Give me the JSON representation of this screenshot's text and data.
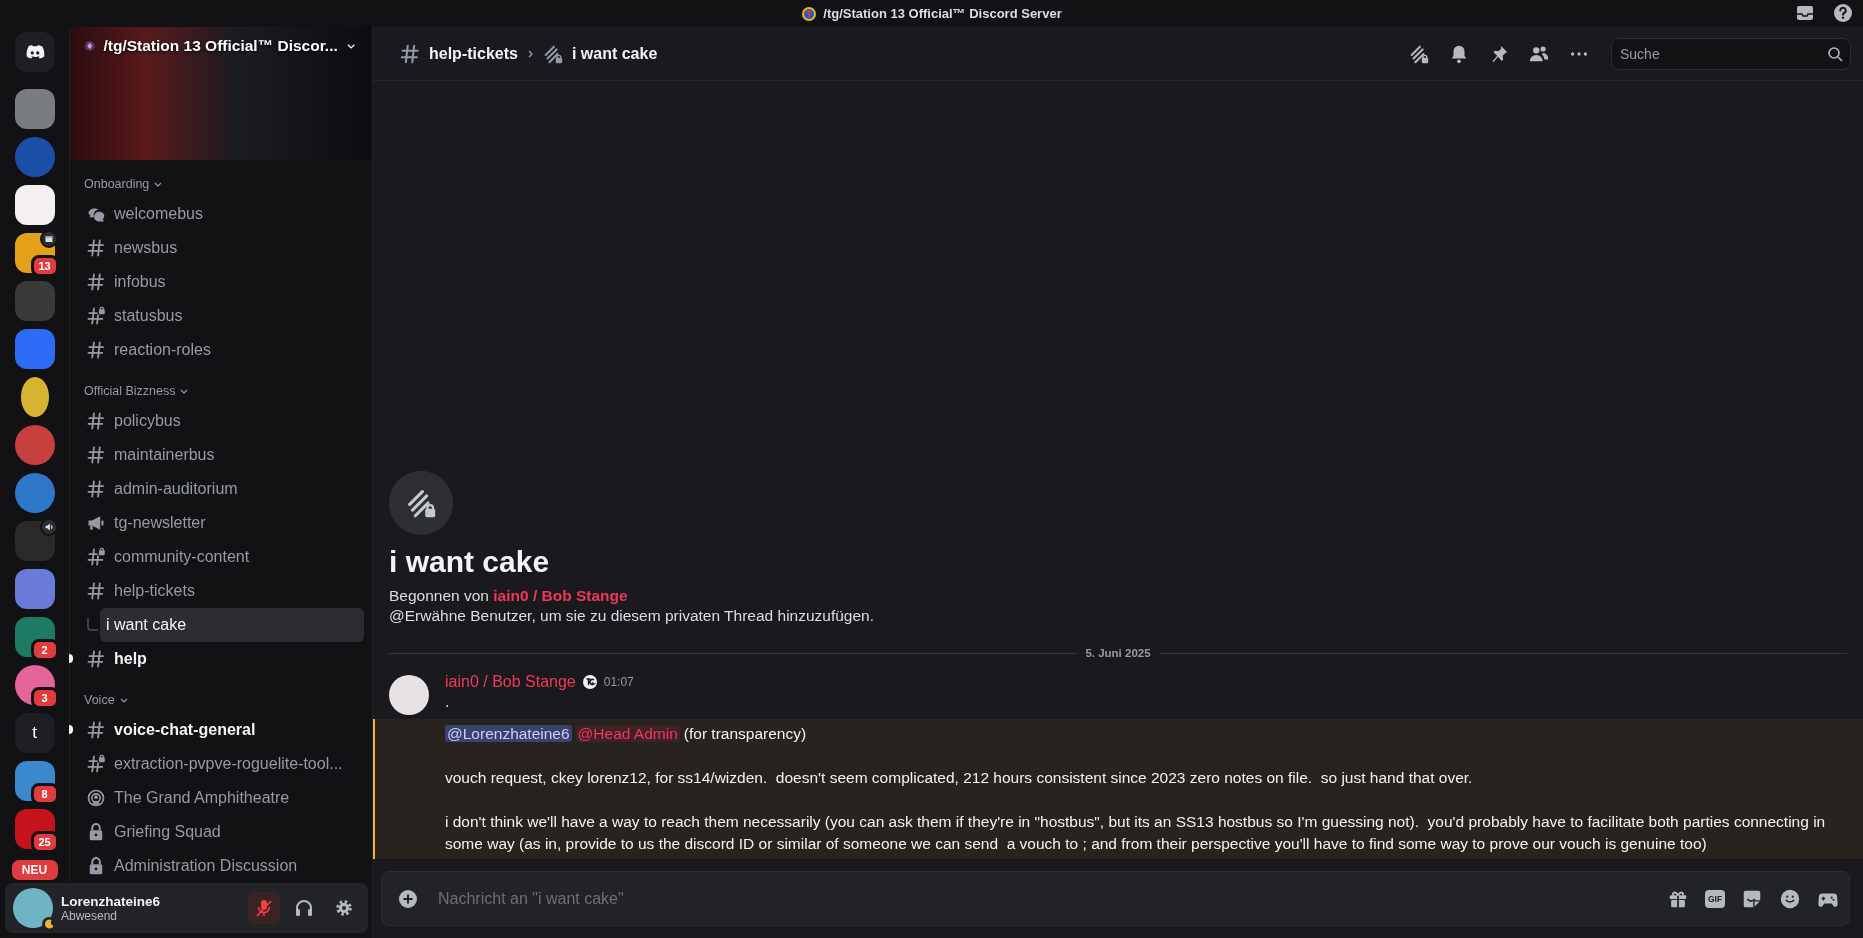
{
  "title_bar": {
    "title": "/tg/Station 13 Official™ Discord Server"
  },
  "servers": [
    {
      "kind": "home"
    },
    {
      "kind": "image"
    },
    {
      "kind": "image"
    },
    {
      "kind": "image"
    },
    {
      "kind": "image",
      "event_icon": true,
      "badge": "13"
    },
    {
      "kind": "image"
    },
    {
      "kind": "image"
    },
    {
      "kind": "image"
    },
    {
      "kind": "image"
    },
    {
      "kind": "image"
    },
    {
      "kind": "image",
      "voice_icon": true
    },
    {
      "kind": "image"
    },
    {
      "kind": "image",
      "badge": "2"
    },
    {
      "kind": "image",
      "badge": "3"
    },
    {
      "kind": "letter",
      "label": "t"
    },
    {
      "kind": "image",
      "badge": "8"
    },
    {
      "kind": "image",
      "badge": "25"
    },
    {
      "kind": "image",
      "new_label": "NEU"
    }
  ],
  "sidebar": {
    "server_name": "/tg/Station 13 Official™ Discor...",
    "categories": [
      {
        "name": "Onboarding",
        "channels": [
          {
            "name": "welcomebus",
            "kind": "forum",
            "unread": false,
            "selected": false
          },
          {
            "name": "newsbus",
            "kind": "text",
            "unread": false,
            "selected": false
          },
          {
            "name": "infobus",
            "kind": "text",
            "unread": false,
            "selected": false
          },
          {
            "name": "statusbus",
            "kind": "text_locked",
            "unread": false,
            "selected": false
          },
          {
            "name": "reaction-roles",
            "kind": "text",
            "unread": false,
            "selected": false
          }
        ]
      },
      {
        "name": "Official Bizzness",
        "channels": [
          {
            "name": "policybus",
            "kind": "text",
            "unread": false,
            "selected": false
          },
          {
            "name": "maintainerbus",
            "kind": "text",
            "unread": false,
            "selected": false
          },
          {
            "name": "admin-auditorium",
            "kind": "text",
            "unread": false,
            "selected": false
          },
          {
            "name": "tg-newsletter",
            "kind": "announcement",
            "unread": false,
            "selected": false
          },
          {
            "name": "community-content",
            "kind": "text_locked",
            "unread": false,
            "selected": false
          },
          {
            "name": "help-tickets",
            "kind": "text",
            "unread": false,
            "selected": false,
            "children": [
              {
                "name": "i want cake",
                "selected": true
              }
            ]
          },
          {
            "name": "help",
            "kind": "text",
            "unread": true,
            "selected": false
          }
        ]
      },
      {
        "name": "Voice",
        "channels": [
          {
            "name": "voice-chat-general",
            "kind": "text",
            "unread": true,
            "selected": false
          },
          {
            "name": "extraction-pvpve-roguelite-tool...",
            "kind": "text_locked",
            "unread": false,
            "selected": false
          },
          {
            "name": "The Grand Amphitheatre",
            "kind": "stage",
            "unread": false,
            "selected": false
          },
          {
            "name": "Griefing Squad",
            "kind": "voice_locked",
            "unread": false,
            "selected": false
          },
          {
            "name": "Administration Discussion",
            "kind": "voice_locked",
            "unread": false,
            "selected": false
          }
        ]
      }
    ]
  },
  "user_panel": {
    "name": "Lorenzhateine6",
    "status": "Abwesend",
    "muted": true
  },
  "header": {
    "channel": "help-tickets",
    "thread": "i want cake",
    "search": {
      "placeholder": "Suche"
    }
  },
  "thread_intro": {
    "title": "i want cake",
    "started_by": "Begonnen von **iain0 / Bob Stange**",
    "hint": "@Erwähne Benutzer, um sie zu diesem privaten Thread hinzuzufügen."
  },
  "date_divider": "5. Juni 2025",
  "message": {
    "author": "iain0 / Bob Stange",
    "time": "01:07",
    "first_line": ".",
    "mention_block": {
      "highlighted": true,
      "paragraphs": [
        {
          "segments": [
            {
              "kind": "user_mention",
              "text": "@Lorenzhateine6"
            },
            {
              "kind": "role_mention",
              "text": "@Head Admin"
            },
            {
              "kind": "text",
              "text": "(for transparency)"
            }
          ]
        },
        {
          "segments": [
            {
              "kind": "text",
              "text": "vouch request, ckey lorenz12, for ss14/wizden.  doesn't seem complicated, 212 hours consistent since 2023 zero notes on file.  so just hand that over."
            }
          ]
        },
        {
          "segments": [
            {
              "kind": "text",
              "text": "i don't think we'll have a way to reach them necessarily (you can ask them if they're in \"hostbus\", but its an SS13 hostbus so I'm guessing not).  you'd probably have to facilitate both parties connecting in some way (as in, provide to us the discord ID or similar of someone we can send  a vouch to ; and from their perspective you'll have to find some way to prove our vouch is genuine too)"
            }
          ]
        }
      ]
    }
  },
  "composer": {
    "placeholder": "Nachricht an \"i want cake\"",
    "gif_label": "GIF"
  }
}
